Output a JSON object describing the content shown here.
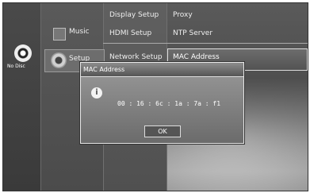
{
  "status": {
    "disc_label": "No Disc"
  },
  "menu": {
    "music_label": "Music",
    "setup_label": "Setup",
    "submenu_items": [
      "Display Setup",
      "HDMI Setup",
      "Network Setup"
    ],
    "right_items": [
      "Proxy",
      "NTP Server",
      "MAC Address"
    ]
  },
  "dialog": {
    "title": "MAC Address",
    "value": "00 : 16 : 6c : 1a : 7a : f1",
    "ok_label": "OK"
  }
}
